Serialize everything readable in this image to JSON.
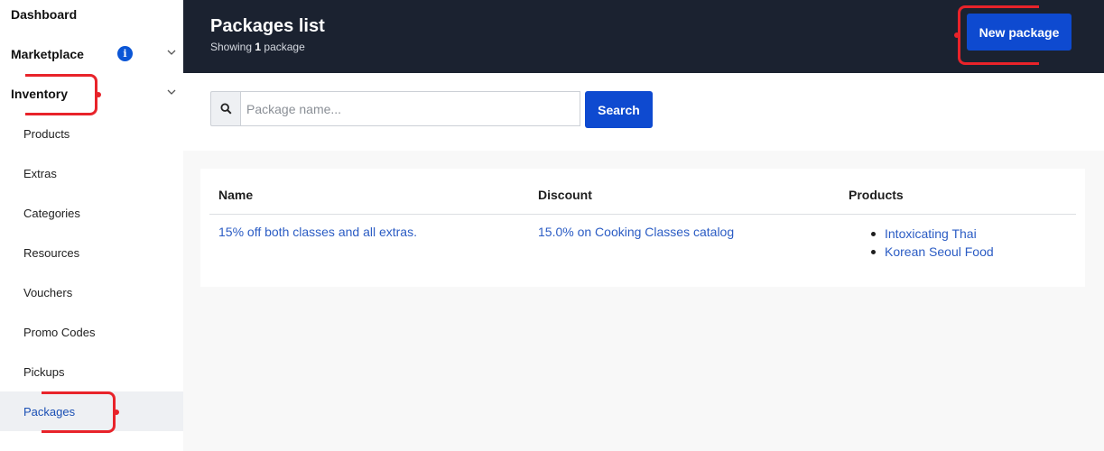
{
  "sidebar": {
    "top_items": [
      {
        "label": "Dashboard"
      },
      {
        "label": "Marketplace"
      },
      {
        "label": "Inventory"
      }
    ],
    "info_icon": "info-icon",
    "sub_items": [
      {
        "label": "Products"
      },
      {
        "label": "Extras"
      },
      {
        "label": "Categories"
      },
      {
        "label": "Resources"
      },
      {
        "label": "Vouchers"
      },
      {
        "label": "Promo Codes"
      },
      {
        "label": "Pickups"
      },
      {
        "label": "Packages",
        "active": true
      }
    ]
  },
  "header": {
    "title": "Packages list",
    "subtitle_prefix": "Showing",
    "count": "1",
    "subtitle_suffix": "package",
    "new_button": "New package"
  },
  "search": {
    "placeholder": "Package name...",
    "value": "",
    "button": "Search"
  },
  "table": {
    "columns": [
      "Name",
      "Discount",
      "Products"
    ],
    "rows": [
      {
        "name": "15% off both classes and all extras.",
        "discount": "15.0% on Cooking Classes catalog",
        "products": [
          "Intoxicating Thai",
          "Korean Seoul Food"
        ]
      }
    ]
  },
  "colors": {
    "header_bg": "#1b2230",
    "primary": "#0e4ad0",
    "link": "#2b5cc4",
    "annotation": "#e8232a"
  }
}
